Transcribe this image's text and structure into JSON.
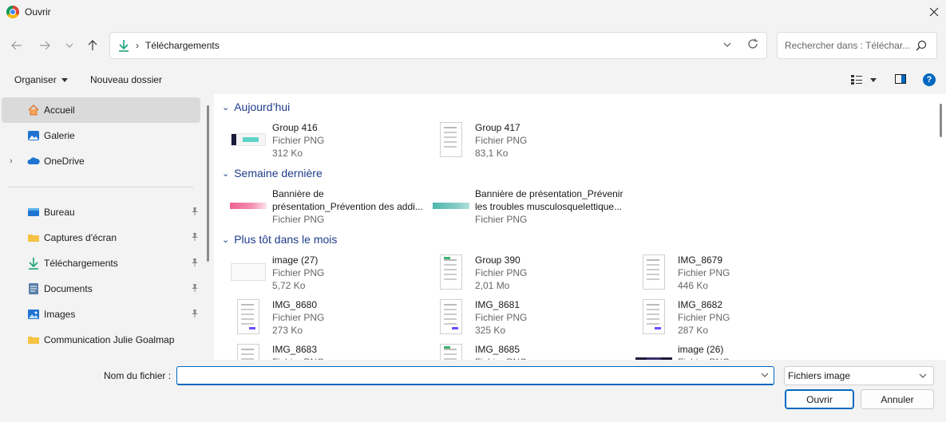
{
  "window": {
    "title": "Ouvrir"
  },
  "nav": {
    "breadcrumb": "Téléchargements",
    "search_placeholder": "Rechercher dans : Téléchar..."
  },
  "toolbar": {
    "organise": "Organiser",
    "new_folder": "Nouveau dossier"
  },
  "sidebar": {
    "items": [
      {
        "label": "Accueil",
        "icon": "home-icon",
        "selected": true
      },
      {
        "label": "Galerie",
        "icon": "gallery-icon"
      },
      {
        "label": "OneDrive",
        "icon": "cloud-icon",
        "expandable": true
      },
      {
        "label": "Bureau",
        "icon": "desktop-icon",
        "pinned": true
      },
      {
        "label": "Captures d'écran",
        "icon": "folder-icon",
        "pinned": true
      },
      {
        "label": "Téléchargements",
        "icon": "download-icon",
        "pinned": true
      },
      {
        "label": "Documents",
        "icon": "documents-icon",
        "pinned": true
      },
      {
        "label": "Images",
        "icon": "images-icon",
        "pinned": true
      },
      {
        "label": "Communication Julie Goalmap",
        "icon": "folder-icon"
      }
    ]
  },
  "groups": [
    {
      "title": "Aujourd’hui",
      "files": [
        {
          "name": "Group 416",
          "type": "Fichier PNG",
          "size": "312 Ko"
        },
        {
          "name": "Group 417",
          "type": "Fichier PNG",
          "size": "83,1 Ko"
        }
      ]
    },
    {
      "title": "Semaine dernière",
      "files": [
        {
          "name": "Bannière de",
          "name2": "présentation_Prévention des addi...",
          "type": "Fichier PNG"
        },
        {
          "name": "Bannière de présentation_Prévenir",
          "name2": "les troubles musculosquelettique...",
          "type": "Fichier PNG"
        }
      ]
    },
    {
      "title": "Plus tôt dans le mois",
      "files": [
        {
          "name": "image (27)",
          "type": "Fichier PNG",
          "size": "5,72 Ko"
        },
        {
          "name": "Group 390",
          "type": "Fichier PNG",
          "size": "2,01 Mo"
        },
        {
          "name": "IMG_8679",
          "type": "Fichier PNG",
          "size": "446 Ko"
        },
        {
          "name": "IMG_8680",
          "type": "Fichier PNG",
          "size": "273 Ko"
        },
        {
          "name": "IMG_8681",
          "type": "Fichier PNG",
          "size": "325 Ko"
        },
        {
          "name": "IMG_8682",
          "type": "Fichier PNG",
          "size": "287 Ko"
        },
        {
          "name": "IMG_8683",
          "type": "Fichier PNG"
        },
        {
          "name": "IMG_8685",
          "type": "Fichier PNG"
        },
        {
          "name": "image (26)",
          "type": "Fichier PNG"
        }
      ]
    }
  ],
  "bottom": {
    "filename_label": "Nom du fichier :",
    "filename_value": "",
    "filter": "Fichiers image",
    "open": "Ouvrir",
    "cancel": "Annuler"
  },
  "colors": {
    "accent": "#0067c0",
    "group_header": "#1f3b8c"
  }
}
